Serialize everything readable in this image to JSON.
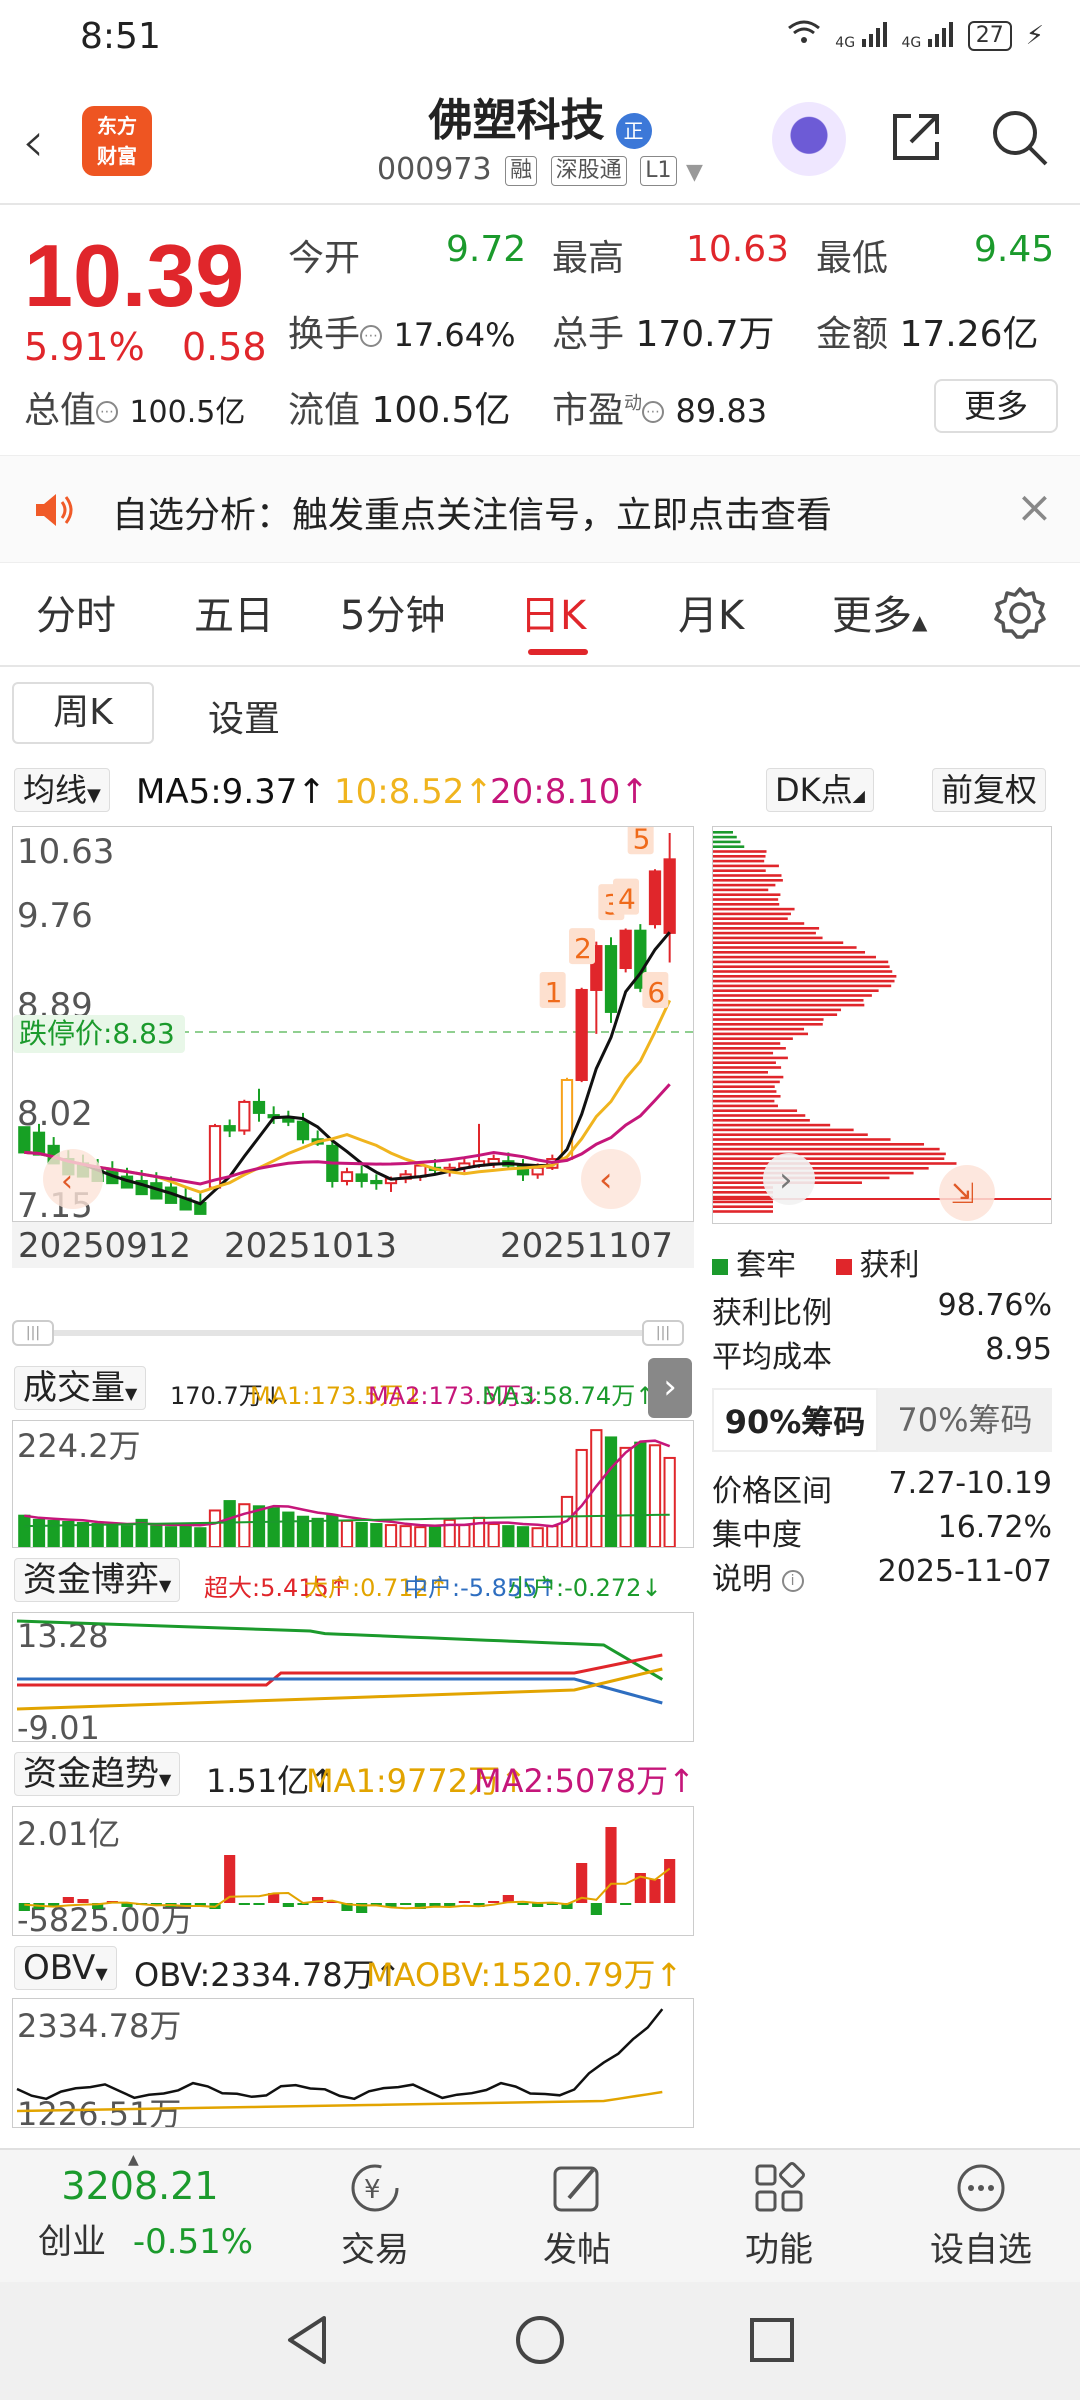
{
  "status_bar": {
    "time": "8:51",
    "network1": "4G",
    "network2": "4G",
    "battery": "27"
  },
  "header": {
    "logo_line1": "东方",
    "logo_line2": "财富",
    "stock_name": "佛塑科技",
    "badge": "正",
    "code": "000973",
    "tags": [
      "融",
      "深股通",
      "L1"
    ]
  },
  "quote": {
    "price": "10.39",
    "pct": "5.91%",
    "change": "0.58",
    "open_label": "今开",
    "open": "9.72",
    "high_label": "最高",
    "high": "10.63",
    "low_label": "最低",
    "low": "9.45",
    "turnover_label": "换手",
    "turnover": "17.64%",
    "volume_label": "总手",
    "volume": "170.7万",
    "amount_label": "金额",
    "amount": "17.26亿",
    "mktcap_label": "总值",
    "mktcap": "100.5亿",
    "float_label": "流值",
    "float": "100.5亿",
    "pe_label": "市盈",
    "pe_sup": "动",
    "pe": "89.83",
    "more": "更多"
  },
  "banner": {
    "text": "自选分析：触发重点关注信号，立即点击查看"
  },
  "tabs": [
    "分时",
    "五日",
    "5分钟",
    "日K",
    "月K",
    "更多"
  ],
  "active_tab": "日K",
  "sub": {
    "weekk": "周K",
    "settings": "设置"
  },
  "kline": {
    "ma_selector": "均线",
    "ma5": "MA5:9.37↑",
    "ma10": "10:8.52↑",
    "ma20": "20:8.10↑",
    "dk": "DK点",
    "adjust": "前复权",
    "price_labels": [
      "10.63",
      "9.76",
      "8.89",
      "8.02",
      "7.15"
    ],
    "limit_down": "跌停价:8.83",
    "dates": [
      "20250912",
      "20251013",
      "20251107"
    ],
    "markers": [
      "1",
      "2",
      "3",
      "4",
      "5",
      "6"
    ],
    "colors": {
      "up": "#e0262b",
      "down": "#17a024",
      "ma5": "#111111",
      "ma10": "#f0b41e",
      "ma20": "#c5167a",
      "orange": "#f7a21b"
    }
  },
  "chart_data": [
    {
      "type": "candlestick",
      "title": "日K",
      "ylim": [
        7.15,
        10.63
      ],
      "x_ticks": [
        "20250912",
        "20251013",
        "20251107"
      ],
      "series": [
        {
          "name": "MA5",
          "value": 9.37
        },
        {
          "name": "MA10",
          "value": 8.52
        },
        {
          "name": "MA20",
          "value": 8.1
        }
      ],
      "ohlc": [
        [
          7.95,
          7.92,
          7.8,
          7.72
        ],
        [
          7.9,
          7.98,
          7.82,
          7.7
        ],
        [
          7.78,
          7.86,
          7.66,
          7.62
        ],
        [
          7.66,
          7.74,
          7.6,
          7.52
        ],
        [
          7.62,
          7.7,
          7.56,
          7.5
        ],
        [
          7.58,
          7.66,
          7.52,
          7.46
        ],
        [
          7.56,
          7.64,
          7.5,
          7.44
        ],
        [
          7.5,
          7.58,
          7.46,
          7.4
        ],
        [
          7.46,
          7.56,
          7.42,
          7.34
        ],
        [
          7.44,
          7.54,
          7.4,
          7.3
        ],
        [
          7.4,
          7.5,
          7.34,
          7.26
        ],
        [
          7.3,
          7.4,
          7.24,
          7.2
        ],
        [
          7.26,
          7.36,
          7.2,
          7.16
        ],
        [
          7.4,
          7.98,
          7.38,
          7.96
        ],
        [
          7.96,
          8.02,
          7.86,
          7.92
        ],
        [
          7.92,
          8.2,
          7.88,
          8.18
        ],
        [
          8.18,
          8.3,
          8.0,
          8.08
        ],
        [
          8.06,
          8.14,
          7.98,
          8.04
        ],
        [
          8.04,
          8.1,
          7.96,
          8.0
        ],
        [
          8.0,
          8.08,
          7.8,
          7.84
        ],
        [
          7.84,
          7.92,
          7.78,
          7.8
        ],
        [
          7.78,
          7.82,
          7.4,
          7.46
        ],
        [
          7.46,
          7.58,
          7.42,
          7.54
        ],
        [
          7.52,
          7.6,
          7.4,
          7.46
        ],
        [
          7.46,
          7.52,
          7.38,
          7.44
        ],
        [
          7.44,
          7.5,
          7.36,
          7.48
        ],
        [
          7.48,
          7.56,
          7.44,
          7.52
        ],
        [
          7.5,
          7.62,
          7.46,
          7.6
        ],
        [
          7.58,
          7.66,
          7.52,
          7.56
        ],
        [
          7.56,
          7.62,
          7.5,
          7.58
        ],
        [
          7.58,
          7.66,
          7.54,
          7.62
        ],
        [
          7.6,
          7.98,
          7.58,
          7.64
        ],
        [
          7.62,
          7.7,
          7.58,
          7.66
        ],
        [
          7.64,
          7.72,
          7.56,
          7.6
        ],
        [
          7.6,
          7.66,
          7.46,
          7.52
        ],
        [
          7.52,
          7.62,
          7.48,
          7.58
        ],
        [
          7.58,
          7.7,
          7.56,
          7.66
        ],
        [
          7.66,
          8.4,
          7.64,
          8.38
        ],
        [
          8.38,
          9.22,
          8.36,
          9.2
        ],
        [
          9.2,
          9.64,
          8.8,
          9.6
        ],
        [
          9.6,
          9.68,
          8.9,
          9.0
        ],
        [
          9.4,
          9.76,
          9.36,
          9.74
        ],
        [
          9.74,
          9.8,
          9.18,
          9.22
        ],
        [
          9.8,
          10.3,
          9.76,
          10.28
        ],
        [
          9.72,
          10.63,
          9.45,
          10.39
        ]
      ],
      "chips": {
        "trapped_color": "#1b9a2c",
        "profit_color": "#e0262b",
        "profit_ratio": 0.9876
      }
    },
    {
      "type": "bar",
      "title": "成交量",
      "ylabel": "224.2万",
      "series": [
        {
          "name": "VOL",
          "values": [
            60,
            52,
            50,
            48,
            46,
            44,
            42,
            40,
            52,
            40,
            38,
            42,
            36,
            70,
            88,
            82,
            78,
            74,
            66,
            58,
            54,
            60,
            50,
            46,
            44,
            42,
            40,
            38,
            40,
            52,
            42,
            56,
            44,
            40,
            38,
            36,
            40,
            96,
            186,
            224,
            210,
            190,
            200,
            195,
            170.7
          ]
        },
        {
          "name": "MA1",
          "value": "173.5万"
        },
        {
          "name": "MA2",
          "value": "173.5万"
        },
        {
          "name": "MA3",
          "value": "58.74万"
        }
      ]
    },
    {
      "type": "line",
      "title": "资金博弈",
      "ylim": [
        -9.01,
        13.28
      ],
      "series": [
        {
          "name": "超大",
          "value": 5.415
        },
        {
          "name": "大户",
          "value": 0.712
        },
        {
          "name": "中户",
          "value": -5.855
        },
        {
          "name": "小户",
          "value": -0.272
        }
      ]
    },
    {
      "type": "bar",
      "title": "资金趋势",
      "ylim": [
        -5825.0,
        20100
      ],
      "series": [
        {
          "name": "资金趋势",
          "value": "1.51亿"
        },
        {
          "name": "MA1",
          "value": "9772万"
        },
        {
          "name": "MA2",
          "value": "5078万"
        }
      ]
    },
    {
      "type": "line",
      "title": "OBV",
      "ylim": [
        1226.51,
        2334.78
      ],
      "series": [
        {
          "name": "OBV",
          "value": "2334.78万"
        },
        {
          "name": "MAOBV",
          "value": "1520.79万"
        }
      ]
    }
  ],
  "volume": {
    "label": "成交量",
    "ma_text": "170.7万↓",
    "ma1": "MA1:173.5万↓",
    "ma2": "MA2:173.5万↓",
    "ma3": "MA3:58.74万↑",
    "max": "224.2万"
  },
  "fund_game": {
    "label": "资金博弈",
    "super": "超大:5.415↑",
    "big": "大户:0.712↑",
    "mid": "中户:-5.855↑",
    "small": "小户:-0.272↓",
    "max": "13.28",
    "min": "-9.01"
  },
  "fund_trend": {
    "label": "资金趋势",
    "value": "1.51亿↑",
    "ma1": "MA1:9772万↑",
    "ma2": "MA2:5078万↑",
    "max": "2.01亿",
    "min": "-5825.00万"
  },
  "obv": {
    "label": "OBV",
    "value": "OBV:2334.78万↑",
    "maobv": "MAOBV:1520.79万↑",
    "max": "2334.78万",
    "min": "1226.51万"
  },
  "chips_panel": {
    "legend_trapped": "套牢",
    "legend_profit": "获利",
    "profit_ratio_label": "获利比例",
    "profit_ratio": "98.76%",
    "avg_cost_label": "平均成本",
    "avg_cost": "8.95",
    "tab90": "90%筹码",
    "tab70": "70%筹码",
    "range_label": "价格区间",
    "range": "7.27-10.19",
    "concentration_label": "集中度",
    "concentration": "16.72%",
    "note_label": "说明",
    "note_date": "2025-11-07"
  },
  "bottom_nav": {
    "index_value": "3208.21",
    "index_name": "创业",
    "index_pct": "-0.51%",
    "trade": "交易",
    "post": "发帖",
    "func": "功能",
    "watch": "设自选"
  }
}
